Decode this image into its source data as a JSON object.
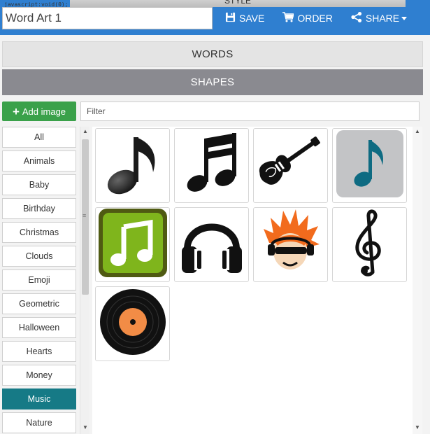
{
  "header": {
    "js_tooltip": "javascript:void(0);",
    "style_tab_label": "STYLE",
    "title_value": "Word Art 1",
    "actions": [
      {
        "label": "SAVE",
        "icon": "floppy-disk-icon"
      },
      {
        "label": "ORDER",
        "icon": "cart-icon"
      },
      {
        "label": "SHARE",
        "icon": "share-icon"
      }
    ]
  },
  "sections": {
    "words": "WORDS",
    "shapes": "SHAPES"
  },
  "toolbar": {
    "add_image_label": "Add image",
    "filter_placeholder": "Filter"
  },
  "categories": [
    {
      "label": "All"
    },
    {
      "label": "Animals"
    },
    {
      "label": "Baby"
    },
    {
      "label": "Birthday"
    },
    {
      "label": "Christmas"
    },
    {
      "label": "Clouds"
    },
    {
      "label": "Emoji"
    },
    {
      "label": "Geometric"
    },
    {
      "label": "Halloween"
    },
    {
      "label": "Hearts"
    },
    {
      "label": "Money"
    },
    {
      "label": "Music",
      "active": true
    },
    {
      "label": "Nature"
    }
  ],
  "shapes": [
    {
      "icon": "eighth-note-icon"
    },
    {
      "icon": "beamed-notes-icon"
    },
    {
      "icon": "electric-guitar-icon"
    },
    {
      "icon": "teal-note-tile-icon"
    },
    {
      "icon": "green-music-app-icon"
    },
    {
      "icon": "headphones-icon"
    },
    {
      "icon": "cartoon-dj-icon"
    },
    {
      "icon": "treble-clef-icon"
    },
    {
      "icon": "vinyl-record-icon"
    }
  ],
  "colors": {
    "topbar": "#2f7fd0",
    "active_category": "#167a86",
    "add_button": "#3aa14a",
    "shapes_header": "#8a8a90"
  }
}
